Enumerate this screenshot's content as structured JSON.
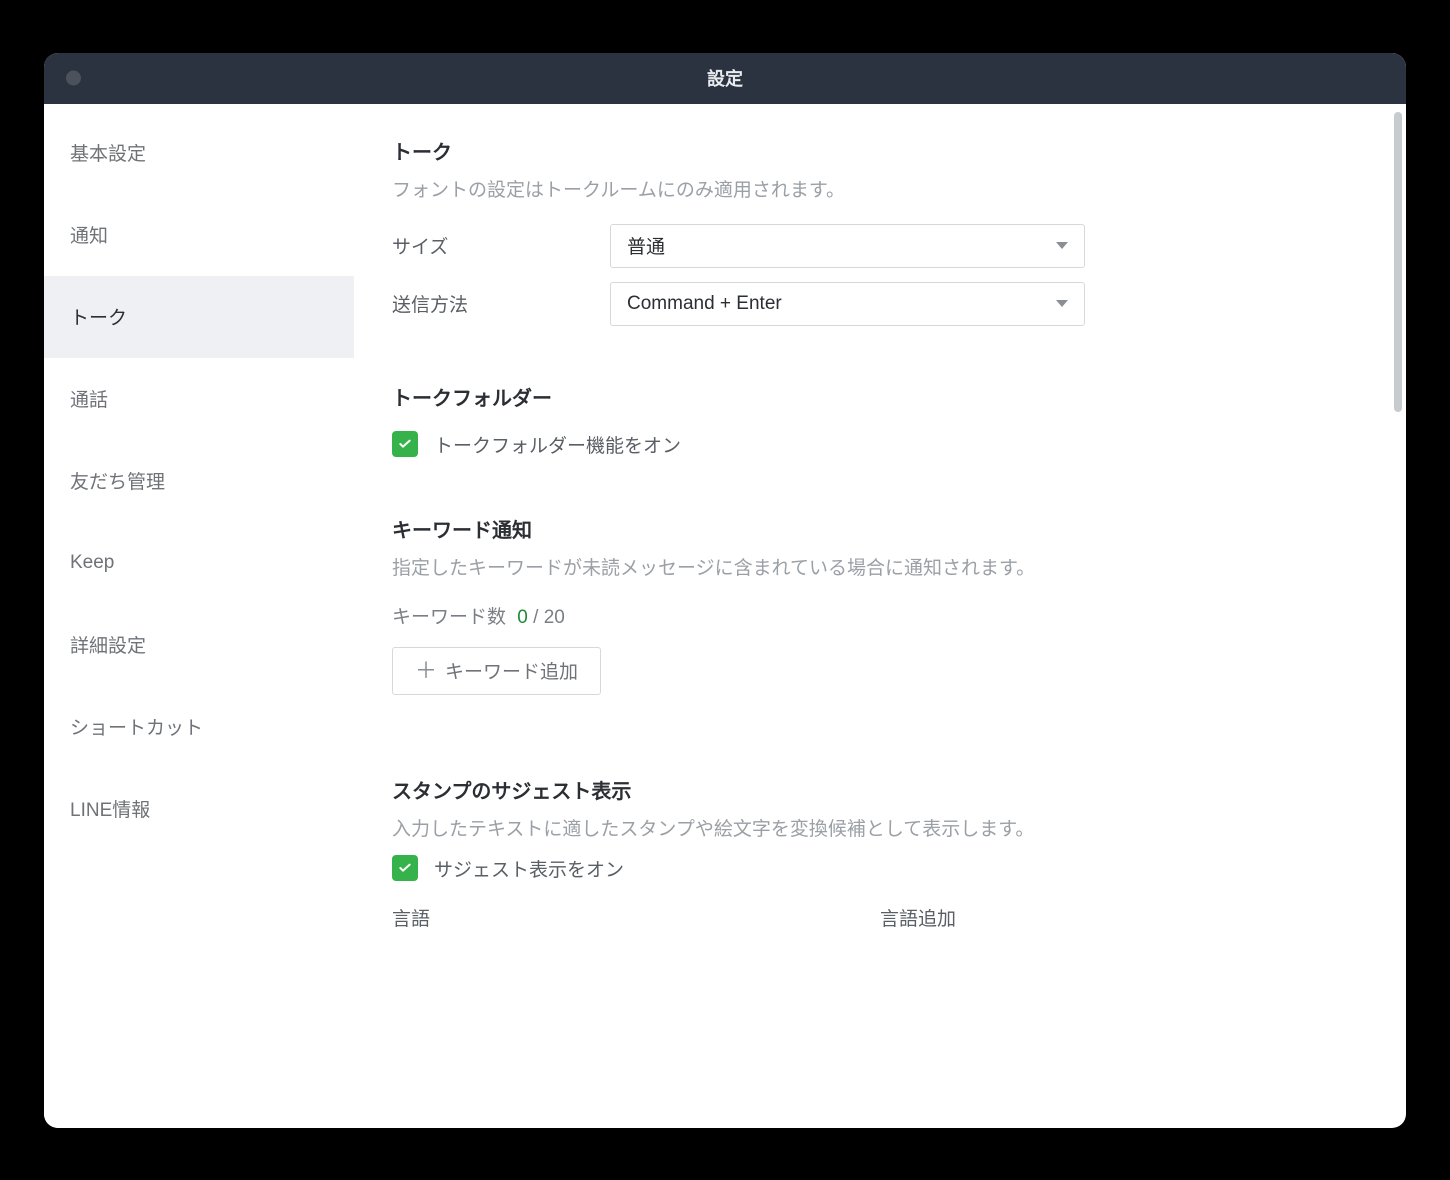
{
  "window": {
    "title": "設定"
  },
  "sidebar": {
    "items": [
      {
        "label": "基本設定",
        "active": false
      },
      {
        "label": "通知",
        "active": false
      },
      {
        "label": "トーク",
        "active": true
      },
      {
        "label": "通話",
        "active": false
      },
      {
        "label": "友だち管理",
        "active": false
      },
      {
        "label": "Keep",
        "active": false
      },
      {
        "label": "詳細設定",
        "active": false
      },
      {
        "label": "ショートカット",
        "active": false
      },
      {
        "label": "LINE情報",
        "active": false
      }
    ]
  },
  "talk": {
    "title": "トーク",
    "desc": "フォントの設定はトークルームにのみ適用されます。",
    "size_label": "サイズ",
    "size_value": "普通",
    "send_label": "送信方法",
    "send_value": "Command + Enter"
  },
  "folder": {
    "title": "トークフォルダー",
    "checkbox_label": "トークフォルダー機能をオン",
    "checked": true
  },
  "keyword": {
    "title": "キーワード通知",
    "desc": "指定したキーワードが未読メッセージに含まれている場合に通知されます。",
    "count_label": "キーワード数",
    "count": "0",
    "sep": " / ",
    "max": "20",
    "add_label": "キーワード追加"
  },
  "sticker": {
    "title": "スタンプのサジェスト表示",
    "desc": "入力したテキストに適したスタンプや絵文字を変換候補として表示します。",
    "checkbox_label": "サジェスト表示をオン",
    "checked": true,
    "lang_label": "言語",
    "lang_add_label": "言語追加"
  }
}
